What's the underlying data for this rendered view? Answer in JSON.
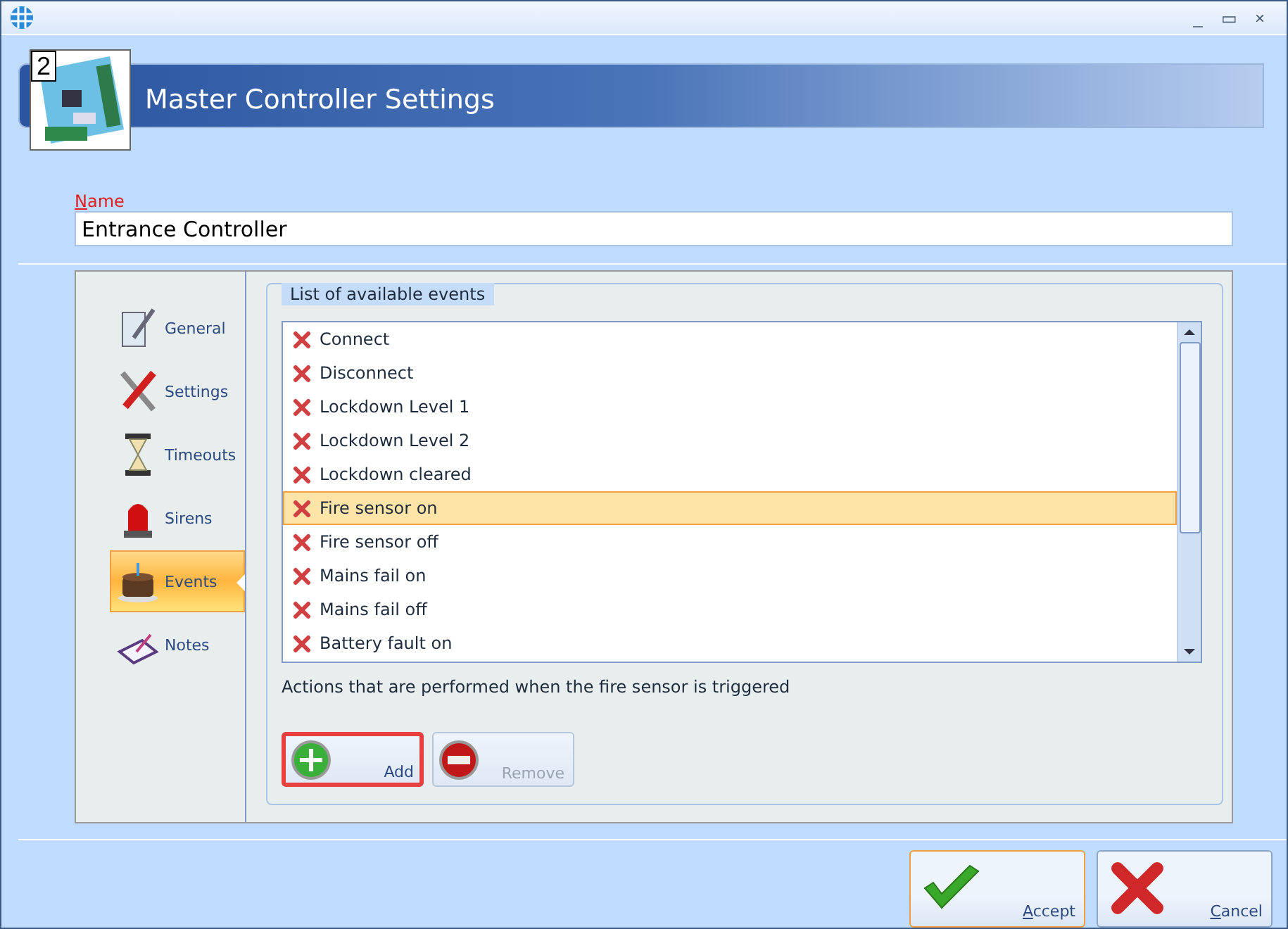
{
  "window": {
    "title_bar_controls": [
      "_",
      "▭",
      "×"
    ]
  },
  "header": {
    "badge": "2",
    "title": "Master Controller Settings"
  },
  "name_field": {
    "label": "Name",
    "value": "Entrance Controller"
  },
  "sidebar": {
    "items": [
      {
        "label": "General",
        "kind": "general",
        "selected": false
      },
      {
        "label": "Settings",
        "kind": "tools",
        "selected": false
      },
      {
        "label": "Timeouts",
        "kind": "hourglass",
        "selected": false
      },
      {
        "label": "Sirens",
        "kind": "siren",
        "selected": false
      },
      {
        "label": "Events",
        "kind": "cake",
        "selected": true
      },
      {
        "label": "Notes",
        "kind": "notes",
        "selected": false
      }
    ]
  },
  "events_group": {
    "legend": "List of available events",
    "events": [
      {
        "label": "Connect",
        "selected": false
      },
      {
        "label": "Disconnect",
        "selected": false
      },
      {
        "label": "Lockdown Level 1",
        "selected": false
      },
      {
        "label": "Lockdown Level 2",
        "selected": false
      },
      {
        "label": "Lockdown cleared",
        "selected": false
      },
      {
        "label": "Fire sensor on",
        "selected": true
      },
      {
        "label": "Fire sensor off",
        "selected": false
      },
      {
        "label": "Mains fail on",
        "selected": false
      },
      {
        "label": "Mains fail off",
        "selected": false
      },
      {
        "label": "Battery fault on",
        "selected": false
      }
    ],
    "description": "Actions that are performed when the fire sensor is triggered",
    "action_buttons": [
      {
        "label": "Add",
        "kind": "add",
        "disabled": false,
        "highlighted": true
      },
      {
        "label": "Remove",
        "kind": "remove",
        "disabled": true,
        "highlighted": false
      }
    ]
  },
  "dialog_buttons": [
    {
      "label": "Accept",
      "kind": "accept",
      "default": true
    },
    {
      "label": "Cancel",
      "kind": "cancel",
      "default": false
    }
  ]
}
